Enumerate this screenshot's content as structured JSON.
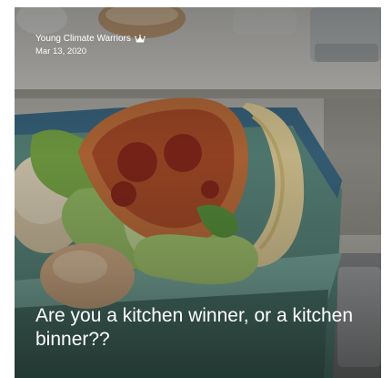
{
  "post": {
    "author": "Young Climate Warriors",
    "date": "Mar 13, 2020",
    "title": "Are you a kitchen winner, or a kitchen binner??",
    "author_badge_icon": "crown-icon",
    "image_subject": "food-waste-bin-photo"
  },
  "colors": {
    "text": "#ffffff",
    "bin_green": "#6fa89a",
    "counter": "#cfcfc9"
  }
}
